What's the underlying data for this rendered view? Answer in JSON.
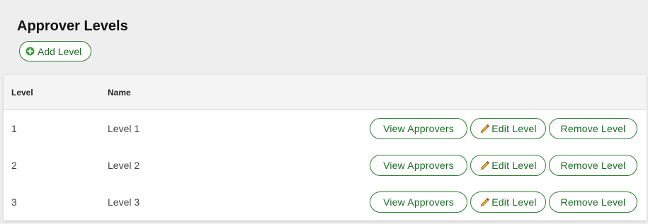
{
  "page": {
    "title": "Approver Levels",
    "add_button_label": "Add Level"
  },
  "table": {
    "columns": [
      "Level",
      "Name"
    ],
    "rows": [
      {
        "level": "1",
        "name": "Level 1"
      },
      {
        "level": "2",
        "name": "Level 2"
      },
      {
        "level": "3",
        "name": "Level 3"
      }
    ],
    "row_actions": {
      "view": "View Approvers",
      "edit": "Edit Level",
      "remove": "Remove Level"
    }
  },
  "icons": {
    "add": "plus-circle-icon",
    "edit": "pencil-icon"
  },
  "colors": {
    "accent": "#2e7d32",
    "button_text": "#1b6b26",
    "plus_icon_fill": "#3f9f3f",
    "page_background": "#eeeeee",
    "header_background": "#f4f4f4"
  }
}
